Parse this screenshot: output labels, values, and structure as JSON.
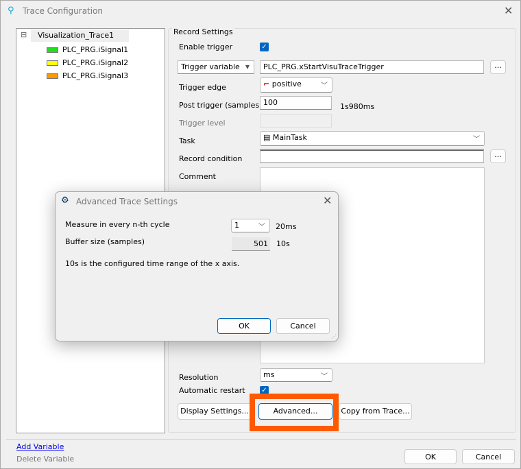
{
  "window": {
    "title": "Trace Configuration",
    "close": "✕"
  },
  "tree": {
    "root": "Visualization_Trace1",
    "expander": "⊟",
    "items": [
      {
        "label": "PLC_PRG.iSignal1",
        "color": "#22dd22"
      },
      {
        "label": "PLC_PRG.iSignal2",
        "color": "#ffff00"
      },
      {
        "label": "PLC_PRG.iSignal3",
        "color": "#ff9900"
      }
    ]
  },
  "record": {
    "group_title": "Record Settings",
    "enable_trigger": "Enable trigger",
    "trigger_variable": "Trigger variable",
    "trigger_variable_value": "PLC_PRG.xStartVisuTraceTrigger",
    "browse": "...",
    "trigger_edge": "Trigger edge",
    "trigger_edge_value": "positive",
    "post_trigger": "Post trigger (samples",
    "post_trigger_value": "100",
    "post_trigger_time": "1s980ms",
    "trigger_level": "Trigger  level",
    "task": "Task",
    "task_value": "MainTask",
    "record_condition": "Record condition",
    "comment": "Comment",
    "resolution": "Resolution",
    "resolution_value": "ms",
    "auto_restart": "Automatic restart",
    "display_settings": "Display Settings...",
    "advanced": "Advanced...",
    "copy_from_trace": "Copy from Trace..."
  },
  "footer": {
    "add_variable": "Add Variable",
    "delete_variable": "Delete Variable",
    "ok": "OK",
    "cancel": "Cancel"
  },
  "advanced_dialog": {
    "title": "Advanced Trace Settings",
    "close": "✕",
    "measure_label": "Measure in every n-th cycle",
    "measure_value": "1",
    "measure_time": "20ms",
    "buffer_label": "Buffer size (samples)",
    "buffer_value": "501",
    "buffer_time": "10s",
    "info": "10s is the configured time range of the x axis.",
    "ok": "OK",
    "cancel": "Cancel"
  },
  "highlight_color": "#ff5a00"
}
